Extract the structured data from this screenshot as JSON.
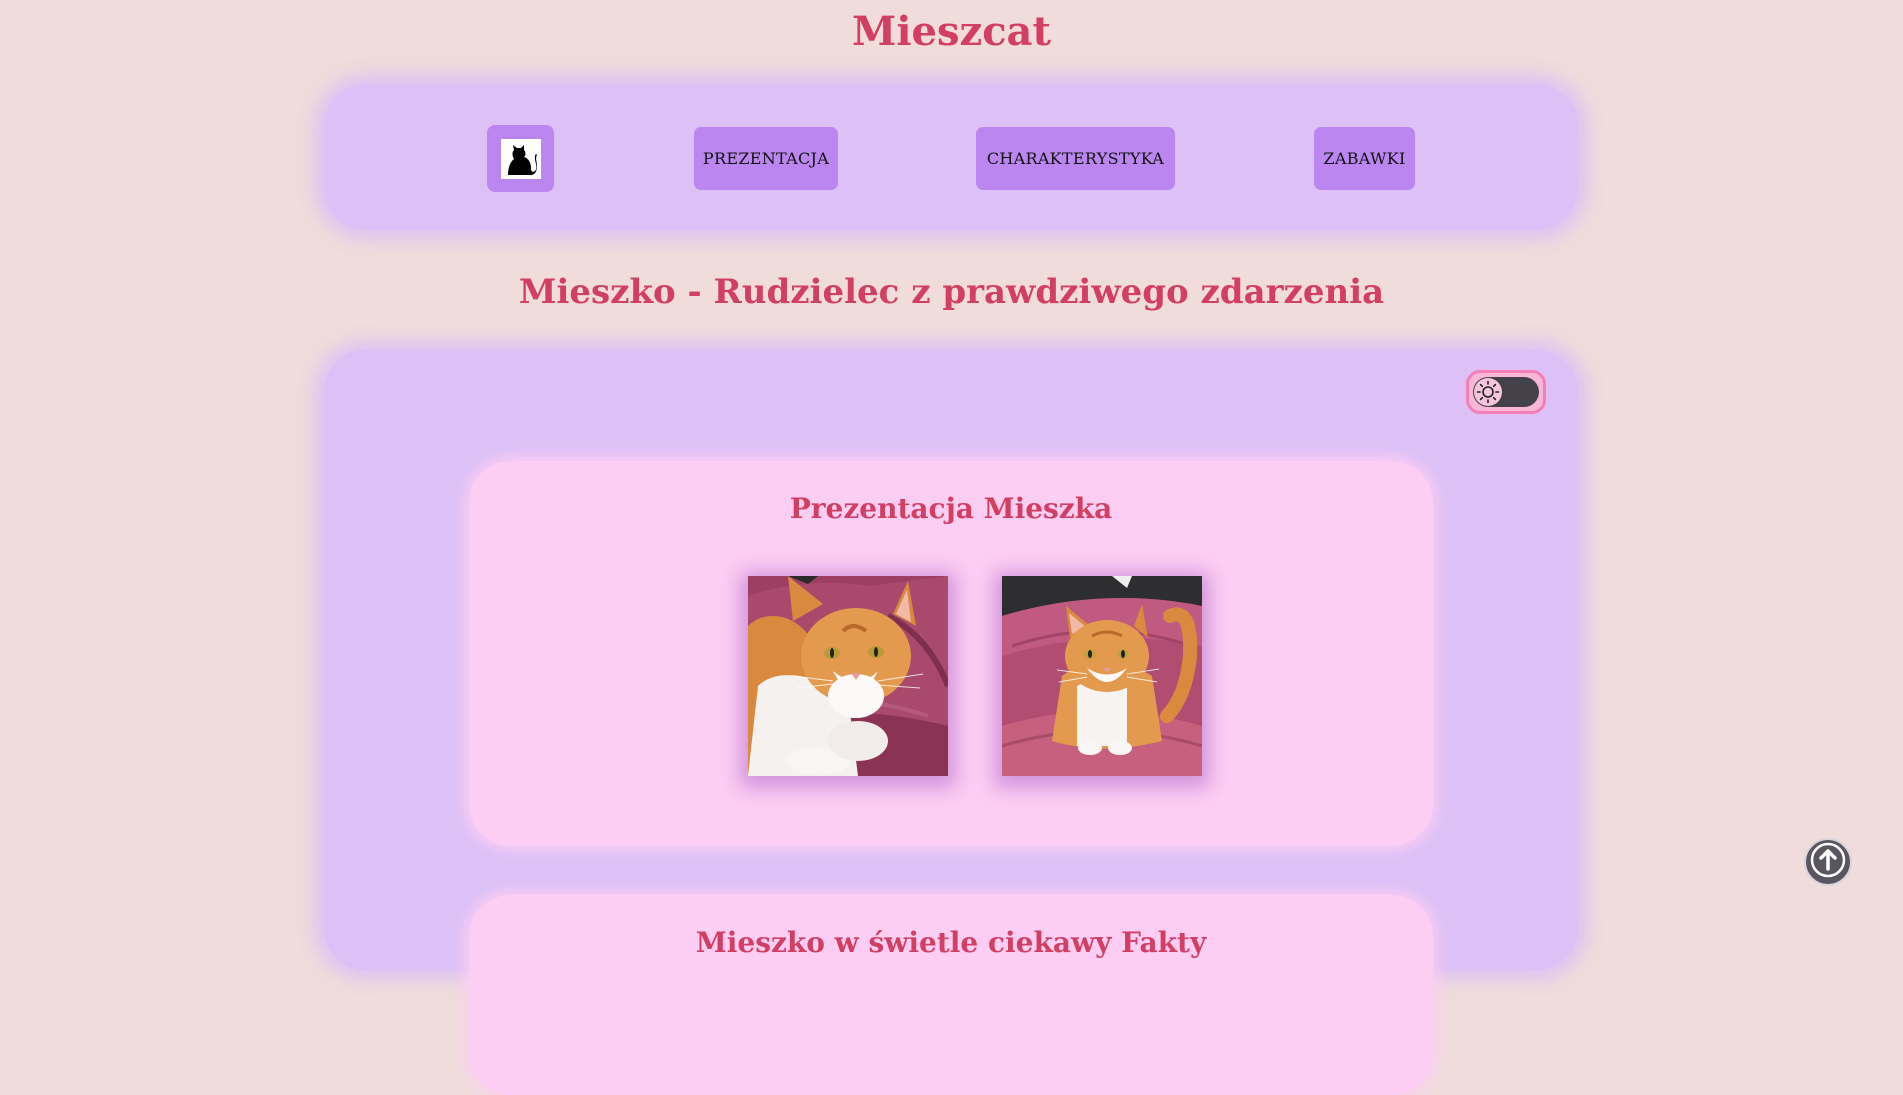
{
  "site": {
    "title": "Mieszcat"
  },
  "nav": {
    "logo_icon": "black-cat-icon",
    "items": [
      {
        "label": "PREZENTACJA"
      },
      {
        "label": "CHARAKTERYSTYKA"
      },
      {
        "label": "ZABAWKI"
      }
    ]
  },
  "page": {
    "heading": "Mieszko - Rudzielec z prawdziwego zdarzenia"
  },
  "theme_toggle": {
    "icon": "sun-icon",
    "state": "light"
  },
  "sections": [
    {
      "title": "Prezentacja Mieszka",
      "photos": [
        {
          "subject": "ginger-white-cat-lying"
        },
        {
          "subject": "ginger-white-cat-sitting"
        }
      ]
    },
    {
      "title": "Mieszko w świetle ciekawy Fakty"
    }
  ],
  "scroll_top": {
    "icon": "arrow-up-circle-icon"
  },
  "colors": {
    "background": "#efdcdb",
    "accent_text": "#d23f63",
    "panel": "#dcc0f6",
    "button": "#bb86f0",
    "card": "#fdcef4"
  }
}
